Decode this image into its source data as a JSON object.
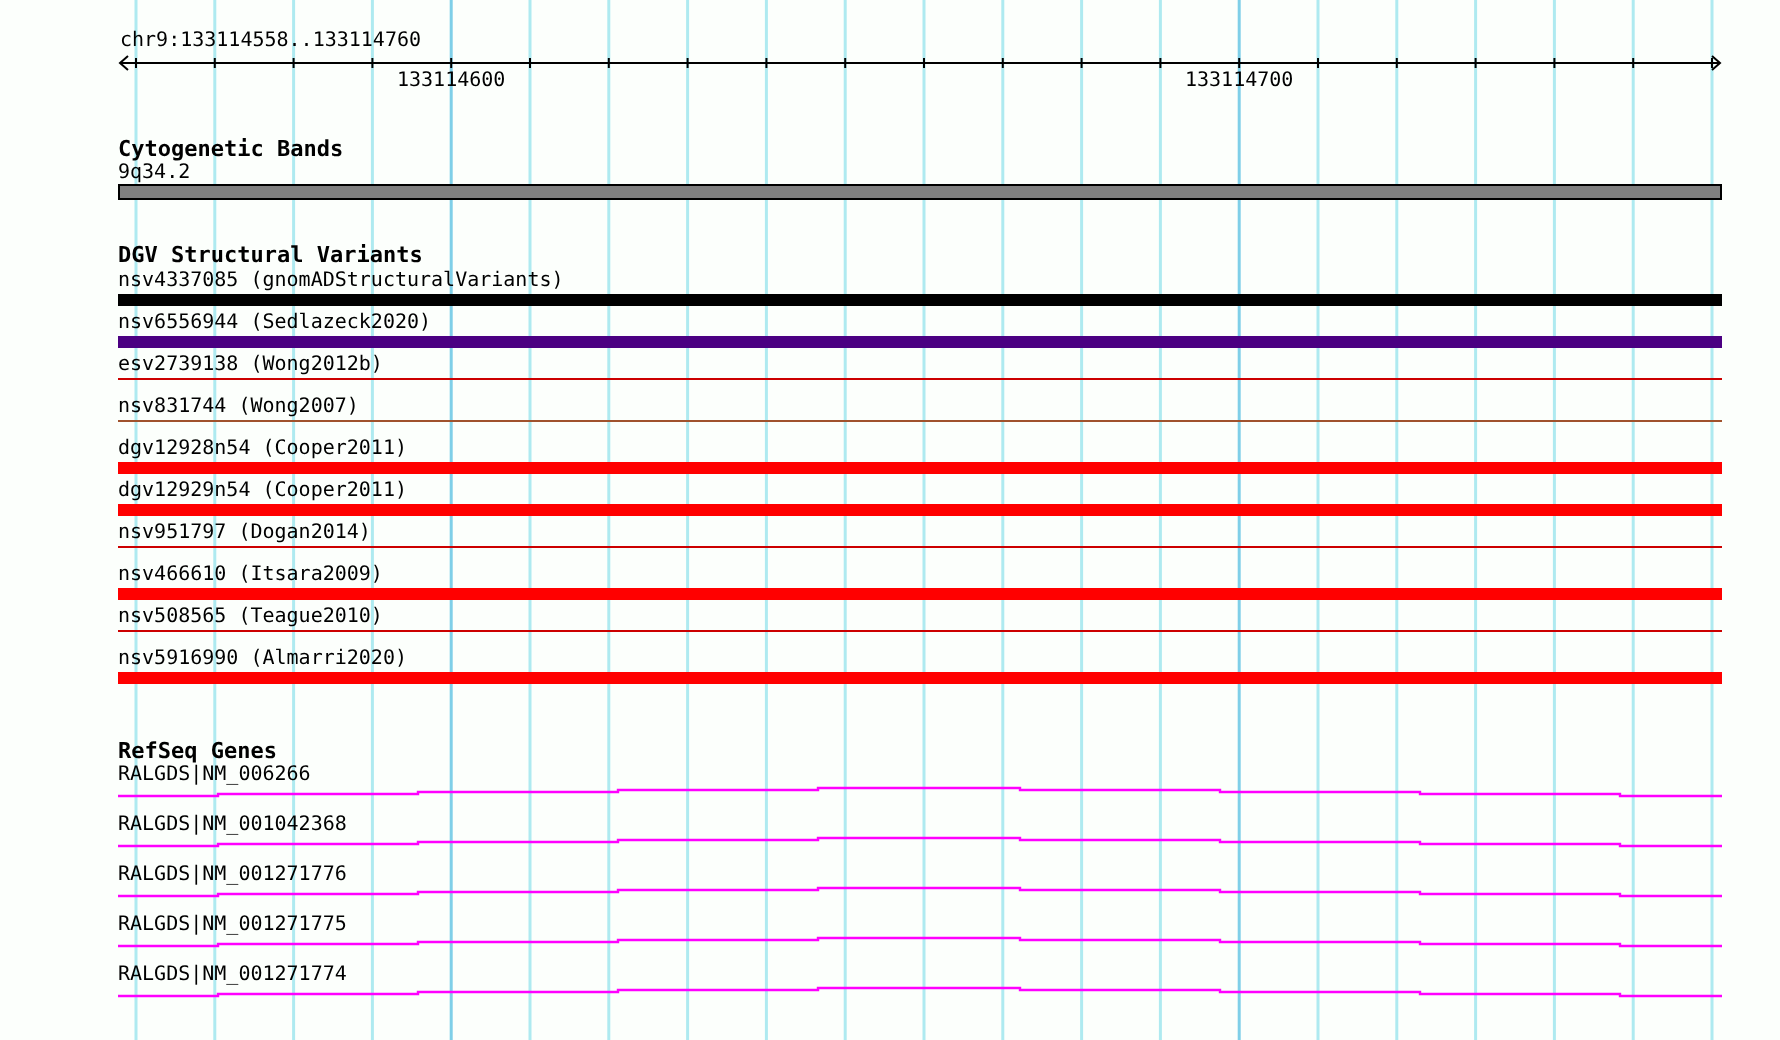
{
  "ruler": {
    "location": "chr9:133114558..133114760",
    "tick_labels": [
      {
        "label": "133114600"
      },
      {
        "label": "133114700"
      }
    ]
  },
  "cytogenetic_bands": {
    "title": "Cytogenetic Bands",
    "bands": [
      {
        "label": "9q34.2"
      }
    ]
  },
  "dgv_structural_variants": {
    "title": "DGV Structural Variants",
    "variants": [
      {
        "label": "nsv4337085 (gnomADStructuralVariants)",
        "color": "#000000",
        "kind": "thick"
      },
      {
        "label": "nsv6556944 (Sedlazeck2020)",
        "color": "#4b0082",
        "kind": "thick"
      },
      {
        "label": "esv2739138 (Wong2012b)",
        "color": "#cc0000",
        "kind": "thin"
      },
      {
        "label": "nsv831744 (Wong2007)",
        "color": "#a0522d",
        "kind": "thin"
      },
      {
        "label": "dgv12928n54 (Cooper2011)",
        "color": "#ff0000",
        "kind": "thick"
      },
      {
        "label": "dgv12929n54 (Cooper2011)",
        "color": "#ff0000",
        "kind": "thick"
      },
      {
        "label": "nsv951797 (Dogan2014)",
        "color": "#cc0000",
        "kind": "thin"
      },
      {
        "label": "nsv466610 (Itsara2009)",
        "color": "#ff0000",
        "kind": "thick"
      },
      {
        "label": "nsv508565 (Teague2010)",
        "color": "#cc0000",
        "kind": "thin"
      },
      {
        "label": "nsv5916990 (Almarri2020)",
        "color": "#ff0000",
        "kind": "thick"
      }
    ]
  },
  "refseq_genes": {
    "title": "RefSeq Genes",
    "genes": [
      {
        "label": "RALGDS|NM_006266"
      },
      {
        "label": "RALGDS|NM_001042368"
      },
      {
        "label": "RALGDS|NM_001271776"
      },
      {
        "label": "RALGDS|NM_001271775"
      },
      {
        "label": "RALGDS|NM_001271774"
      }
    ]
  }
}
